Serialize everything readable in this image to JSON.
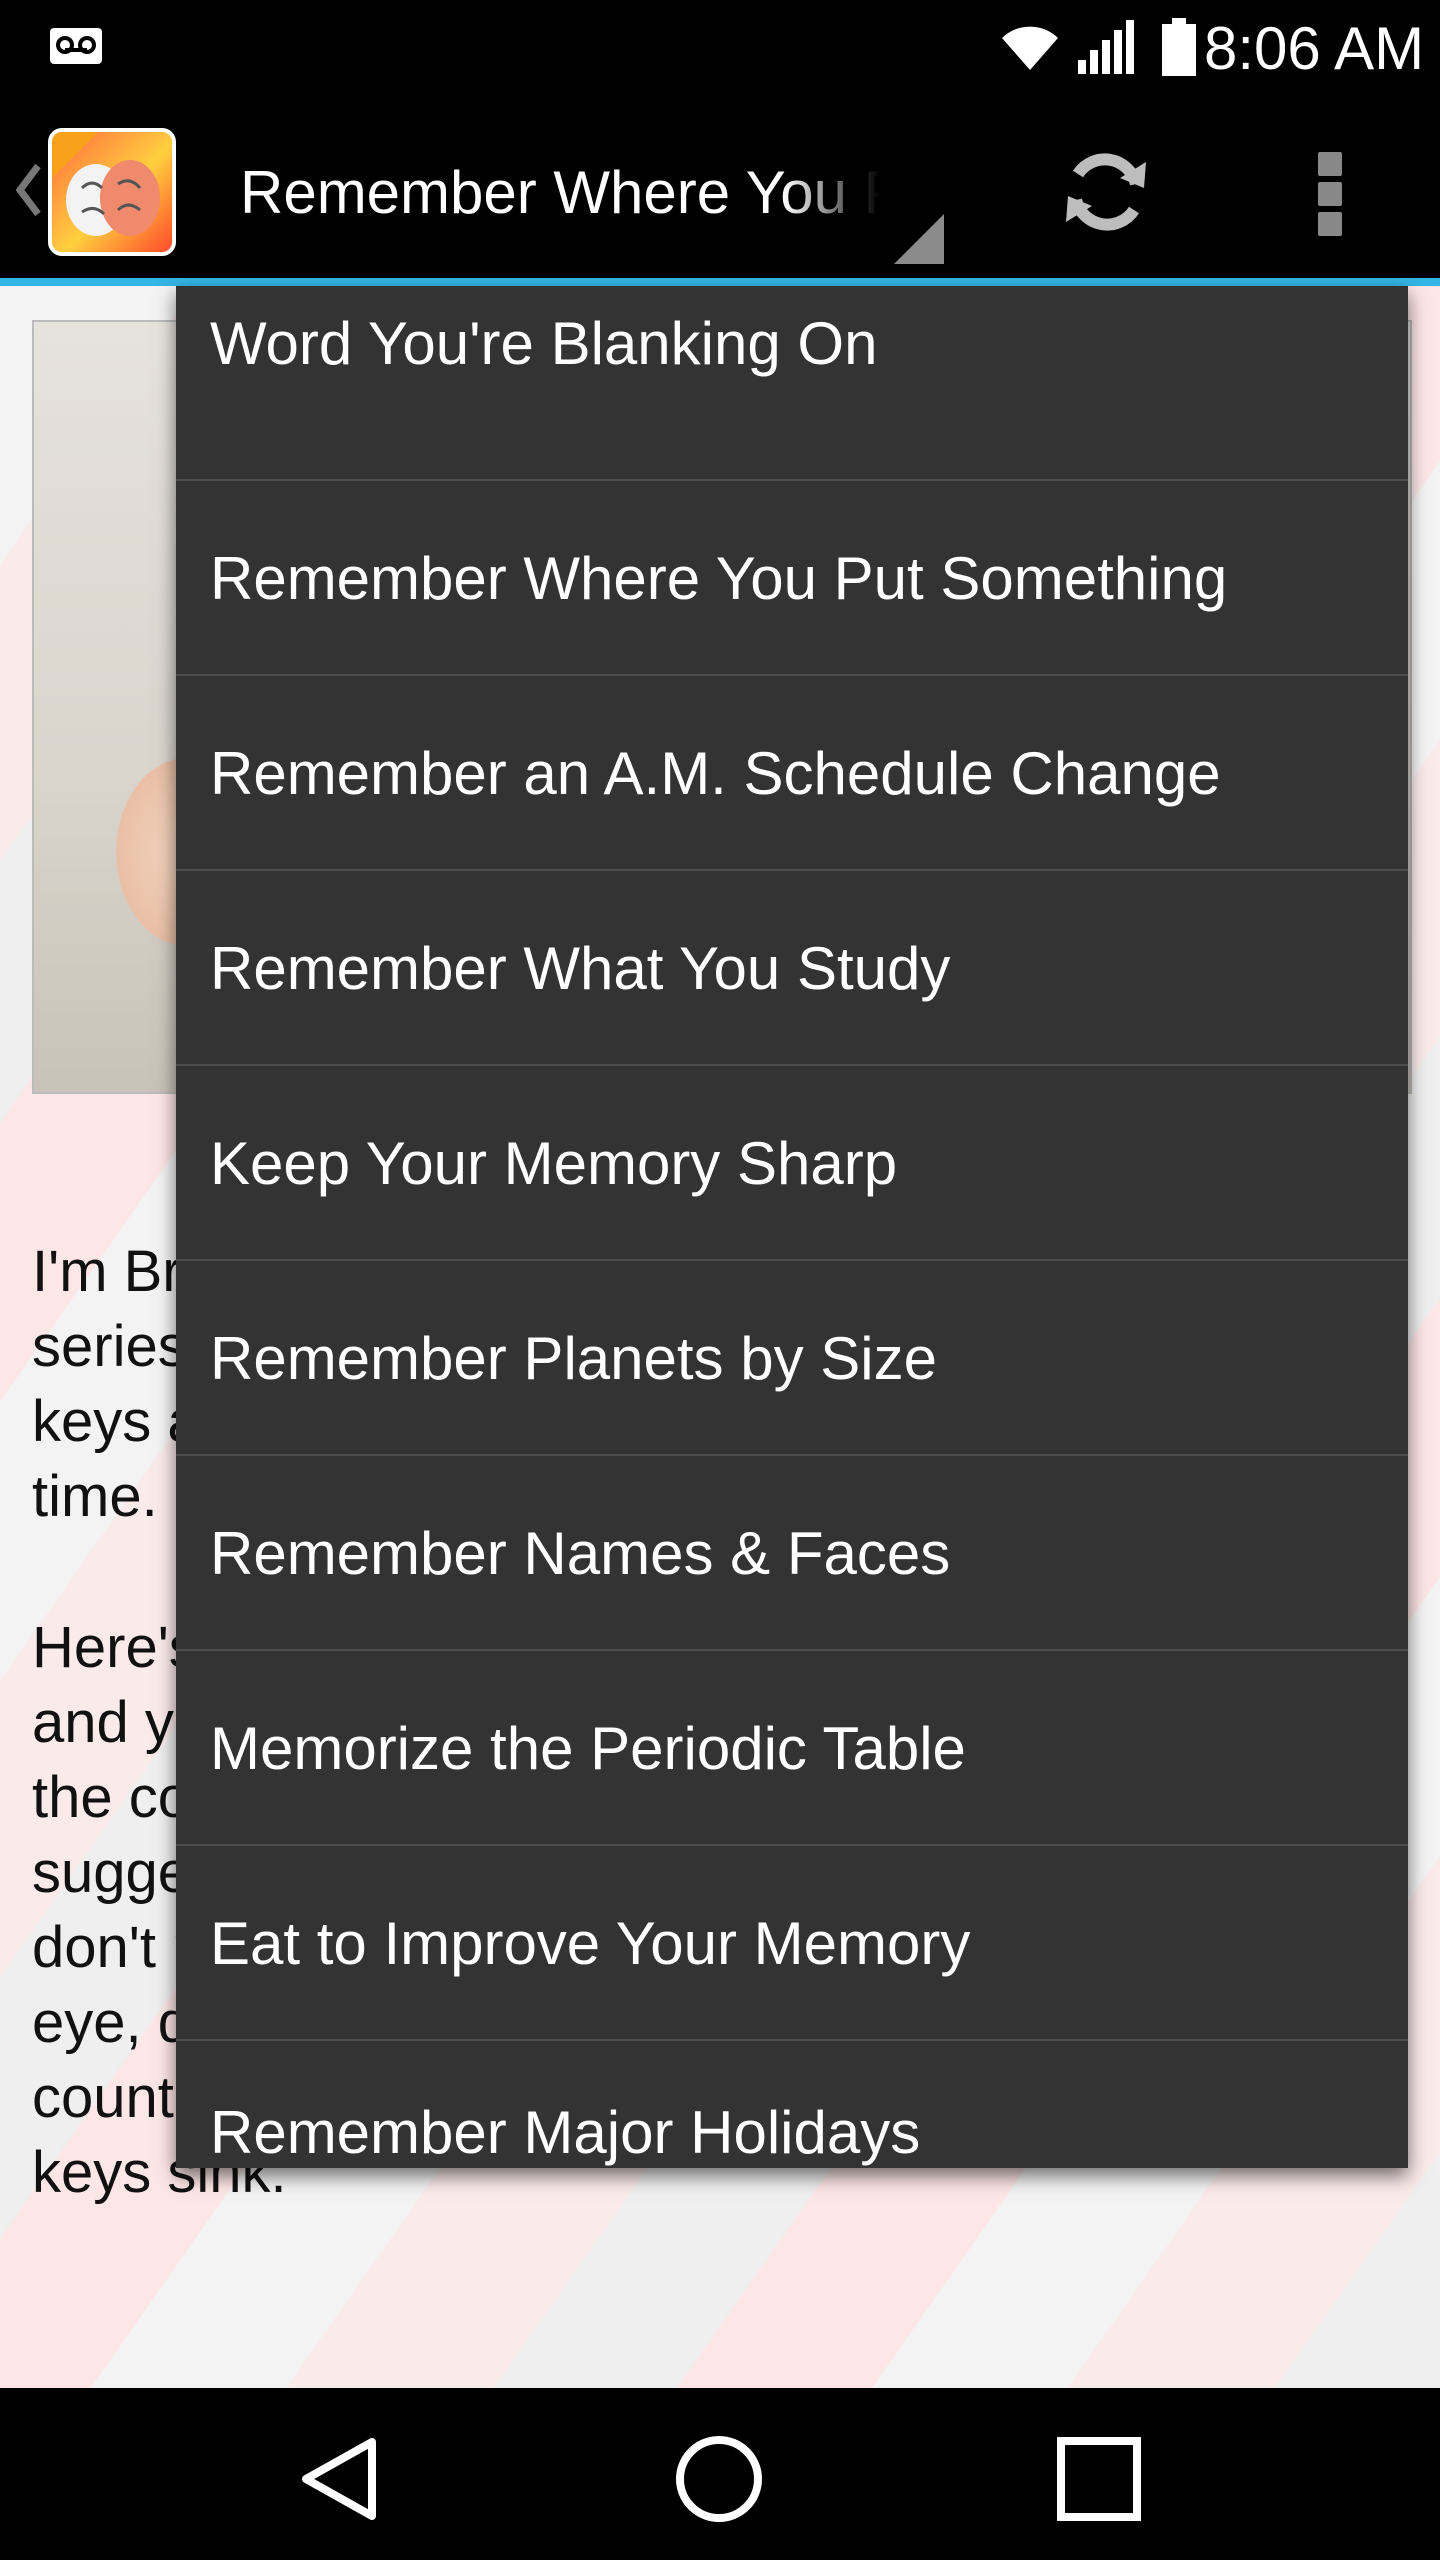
{
  "status_bar": {
    "time": "8:06 AM",
    "icons": [
      "voicemail-icon",
      "wifi-icon",
      "cell-signal-icon",
      "battery-icon"
    ]
  },
  "action_bar": {
    "app_icon": "brain-app-logo",
    "selected_title": "Remember Where You Put Something",
    "actions": [
      "refresh-icon",
      "overflow-menu-icon"
    ]
  },
  "article": {
    "paragraph_1": "I'm Brian Turkel, and as part of my Memory Tricks series I'd like to talk about how to help you put your keys away and know \"where\" they are every single time.",
    "paragraph_2": "Here's a little memory trick: when you come home and you put your keys on the counter or wherever, the counter is the small spot, a nothing space. I'd suggest, when you put them down that you lose, don't put them directly on the counter. In your mind's eye, drop your keys into a glass of milk on the counter. Watch the milk splash off the sides as the keys sink."
  },
  "dropdown": {
    "items": [
      "Word You're Blanking On",
      "Remember Where You Put Something",
      "Remember an A.M. Schedule Change",
      "Remember What You Study",
      "Keep Your Memory Sharp",
      "Remember Planets by Size",
      "Remember Names & Faces",
      "Memorize the Periodic Table",
      "Eat to Improve Your Memory",
      "Remember Major Holidays"
    ]
  },
  "nav_bar": {
    "buttons": [
      "back-icon",
      "home-icon",
      "recents-icon"
    ]
  },
  "colors": {
    "accent": "#33b5e5",
    "dropdown_bg": "#333333",
    "divider": "#4d4d4d"
  }
}
